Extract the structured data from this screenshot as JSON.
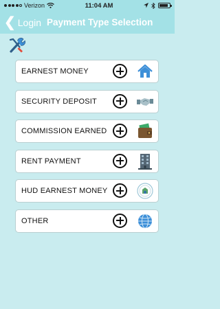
{
  "status": {
    "carrier": "Verizon",
    "time": "11:04 AM"
  },
  "nav": {
    "back_label": "Login",
    "title": "Payment Type Selection"
  },
  "payment_types": [
    {
      "label": "EARNEST MONEY",
      "icon": "house-icon"
    },
    {
      "label": "SECURITY DEPOSIT",
      "icon": "handshake-icon"
    },
    {
      "label": "COMMISSION EARNED",
      "icon": "wallet-icon"
    },
    {
      "label": "RENT PAYMENT",
      "icon": "building-icon"
    },
    {
      "label": "HUD EARNEST MONEY",
      "icon": "hud-seal-icon"
    },
    {
      "label": "OTHER",
      "icon": "globe-icon"
    }
  ],
  "colors": {
    "header": "#a3e1e6",
    "background": "#c9ecef",
    "accent_blue": "#3d8fd8"
  }
}
